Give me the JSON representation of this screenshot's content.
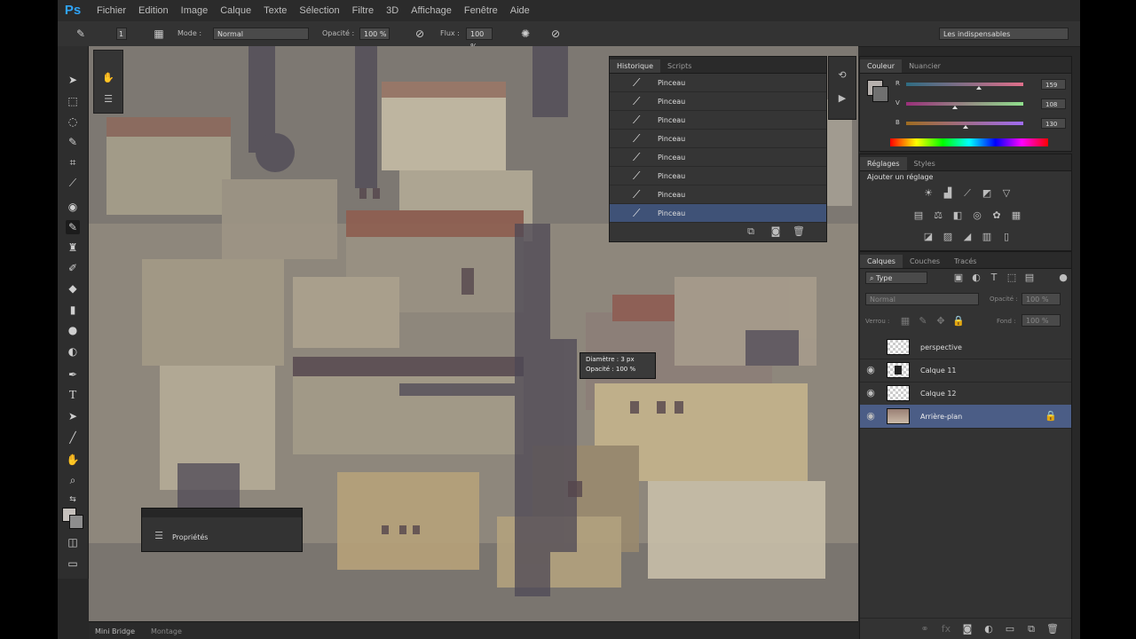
{
  "app": {
    "logo": "Ps"
  },
  "menu": [
    "Fichier",
    "Edition",
    "Image",
    "Calque",
    "Texte",
    "Sélection",
    "Filtre",
    "3D",
    "Affichage",
    "Fenêtre",
    "Aide"
  ],
  "options": {
    "brush_size": "1",
    "mode_label": "Mode :",
    "mode_value": "Normal",
    "opacity_label": "Opacité :",
    "opacity_value": "100 %",
    "flow_label": "Flux :",
    "flow_value": "100 %",
    "workspace": "Les indispensables"
  },
  "history": {
    "tabs": [
      "Historique",
      "Scripts"
    ],
    "items": [
      "Pinceau",
      "Pinceau",
      "Pinceau",
      "Pinceau",
      "Pinceau",
      "Pinceau",
      "Pinceau",
      "Pinceau"
    ]
  },
  "color_panel": {
    "tabs": [
      "Couleur",
      "Nuancier"
    ],
    "r_label": "R",
    "g_label": "V",
    "b_label": "B",
    "r_value": "159",
    "g_value": "108",
    "b_value": "130",
    "r_level": 0.62,
    "g_level": 0.42,
    "b_level": 0.51
  },
  "adjustments": {
    "tabs": [
      "Réglages",
      "Styles"
    ],
    "title": "Ajouter un réglage"
  },
  "layers_panel": {
    "tabs": [
      "Calques",
      "Couches",
      "Tracés"
    ],
    "filter_label": "Type",
    "blend_mode": "Normal",
    "opacity_label": "Opacité :",
    "opacity_value": "100 %",
    "lock_label": "Verrou :",
    "fill_label": "Fond :",
    "fill_value": "100 %",
    "layers": [
      {
        "name": "perspective",
        "visible": false
      },
      {
        "name": "Calque 11",
        "visible": true
      },
      {
        "name": "Calque 12",
        "visible": true
      },
      {
        "name": "Arrière-plan",
        "visible": true,
        "selected": true,
        "locked": true
      }
    ]
  },
  "tooltip": {
    "line1": "Diamètre : 3 px",
    "line2": "Opacité : 100 %"
  },
  "properties": {
    "title": "Propriétés"
  },
  "bottom": {
    "tabs": [
      "Mini Bridge",
      "Montage"
    ]
  },
  "colors": {
    "selection": "#3f5277",
    "layer_selection": "#4b5d86",
    "accent": "#2fa3f6"
  }
}
